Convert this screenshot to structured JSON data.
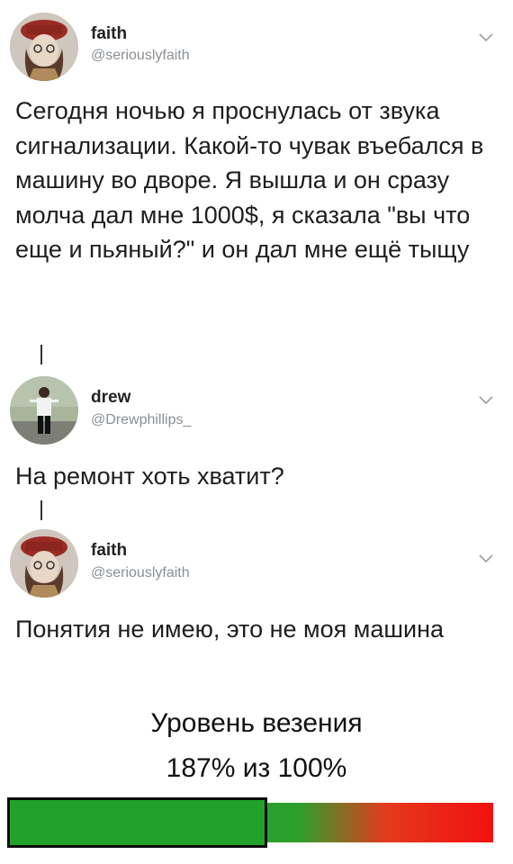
{
  "tweets": [
    {
      "name": "faith",
      "handle": "@seriouslyfaith",
      "text": "Сегодня ночью я проснулась от звука сигнализации. Какой-то чувак въебался в машину во дворе. Я вышла и он сразу молча дал мне 1000$, я сказала \"вы что еще и пьяный?\" и он дал мне ещё тыщу"
    },
    {
      "name": "drew",
      "handle": "@Drewphillips_",
      "text": "На ремонт хоть хватит?"
    },
    {
      "name": "faith",
      "handle": "@seriouslyfaith",
      "text": "Понятия не имею, это не моя машина"
    }
  ],
  "luck_meter": {
    "title": "Уровень везения",
    "value_text": "187% из 100%",
    "value_percent": 187,
    "max_percent": 100,
    "colors": {
      "green": "#22a22a",
      "red": "#f21010"
    }
  },
  "icons": {
    "menu": "chevron-down-icon"
  }
}
